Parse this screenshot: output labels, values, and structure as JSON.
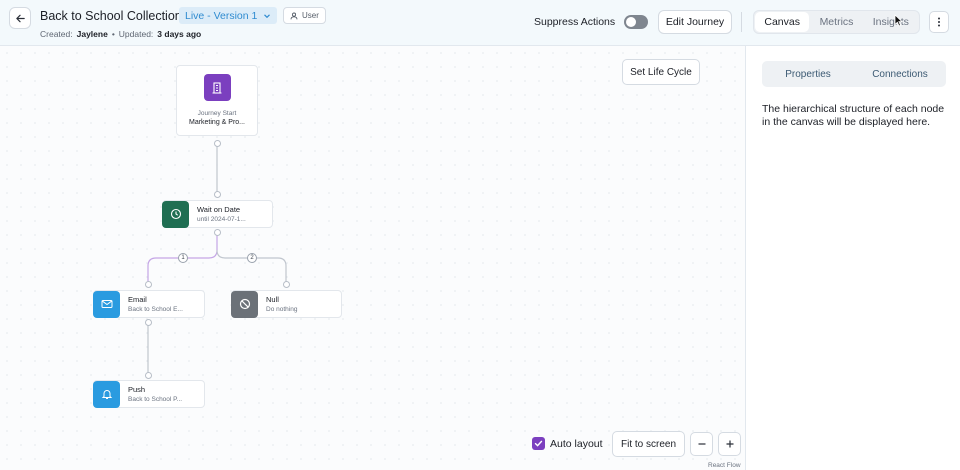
{
  "header": {
    "title": "Back to School Collection",
    "version": "Live - Version 1",
    "user_tag": "User",
    "created_label": "Created:",
    "created_by": "Jaylene",
    "separator": "•",
    "updated_label": "Updated:",
    "updated_value": "3 days ago",
    "suppress_label": "Suppress Actions",
    "suppress_on": false,
    "edit_label": "Edit Journey",
    "tabs": [
      {
        "label": "Canvas",
        "active": true
      },
      {
        "label": "Metrics",
        "active": false
      },
      {
        "label": "Insights",
        "active": false
      }
    ]
  },
  "canvas": {
    "lifecycle_label": "Set Life Cycle",
    "nodes": {
      "start": {
        "title": "Journey Start",
        "subtitle": "Marketing & Pro...",
        "color": "#7b3fbf"
      },
      "wait": {
        "title": "Wait on Date",
        "subtitle": "until 2024-07-1...",
        "color": "#1f6e52"
      },
      "email": {
        "title": "Email",
        "subtitle": "Back to School E...",
        "color": "#2a9be0"
      },
      "null": {
        "title": "Null",
        "subtitle": "Do nothing",
        "color": "#6b7178"
      },
      "push": {
        "title": "Push",
        "subtitle": "Back to School P...",
        "color": "#2a9be0"
      }
    },
    "branches": [
      "1",
      "2"
    ],
    "auto_layout_label": "Auto layout",
    "auto_layout_checked": true,
    "fit_label": "Fit to screen",
    "attribution": "React Flow"
  },
  "panel": {
    "tabs": [
      "Properties",
      "Connections"
    ],
    "description": "The hierarchical structure of each node in the canvas will be displayed here."
  },
  "colors": {
    "accent": "#7b3fbf",
    "branch_edge": "#c5a6e6",
    "edge": "#c0c6ce"
  }
}
